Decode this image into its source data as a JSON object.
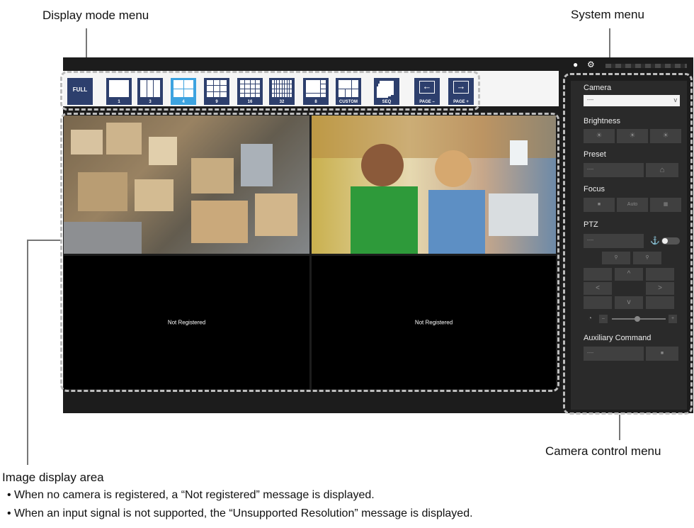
{
  "callouts": {
    "display_mode_menu": "Display mode menu",
    "system_menu": "System menu",
    "camera_control_menu": "Camera control menu",
    "image_display_area": "Image display area"
  },
  "notes": [
    "When no camera is registered, a “Not registered” message is displayed.",
    "When an input signal is not supported, the “Unsupported Resolution” message is displayed."
  ],
  "display_modes": {
    "full": "FULL",
    "m1": "1",
    "m3": "3",
    "m4": "4",
    "m9": "9",
    "m16": "16",
    "m32": "32",
    "m8": "8",
    "custom": "CUSTOM",
    "seq": "SEQ",
    "page_minus": "PAGE –",
    "page_plus": "PAGE +",
    "active": "4"
  },
  "cells": {
    "cell3": "Not Registered",
    "cell4": "Not Registered"
  },
  "panel": {
    "camera_label": "Camera",
    "camera_value": "----",
    "brightness_label": "Brightness",
    "preset_label": "Preset",
    "preset_value": "----",
    "focus_label": "Focus",
    "focus_auto": "Auto",
    "ptz_label": "PTZ",
    "ptz_value": "----",
    "aux_label": "Auxiliary Command",
    "aux_value": "----"
  },
  "colors": {
    "mode_button": "#2d3f6d",
    "mode_button_active": "#3da3e0",
    "panel_bg": "#2a2a2a"
  }
}
